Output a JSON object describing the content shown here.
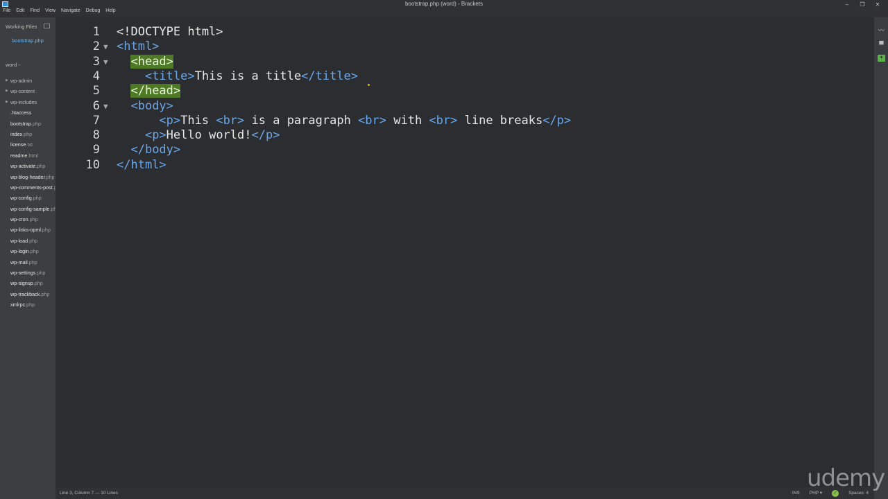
{
  "window": {
    "title": "bootstrap.php (word) - Brackets",
    "controls": [
      "–",
      "❐",
      "✕"
    ]
  },
  "menu": [
    "File",
    "Edit",
    "Find",
    "View",
    "Navigate",
    "Debug",
    "Help"
  ],
  "sidebar": {
    "working_files_label": "Working Files",
    "working_files": [
      "bootstrap.php"
    ],
    "project_label": "word -",
    "tree": [
      {
        "name": "wp-admin",
        "ext": "",
        "folder": true
      },
      {
        "name": "wp-content",
        "ext": "",
        "folder": true
      },
      {
        "name": "wp-includes",
        "ext": "",
        "folder": true
      },
      {
        "name": ".htaccess",
        "ext": "",
        "folder": false
      },
      {
        "name": "bootstrap",
        "ext": ".php",
        "folder": false
      },
      {
        "name": "index",
        "ext": ".php",
        "folder": false
      },
      {
        "name": "license",
        "ext": ".txt",
        "folder": false
      },
      {
        "name": "readme",
        "ext": ".html",
        "folder": false
      },
      {
        "name": "wp-activate",
        "ext": ".php",
        "folder": false
      },
      {
        "name": "wp-blog-header",
        "ext": ".php",
        "folder": false
      },
      {
        "name": "wp-comments-post",
        "ext": ".php",
        "folder": false
      },
      {
        "name": "wp-config",
        "ext": ".php",
        "folder": false
      },
      {
        "name": "wp-config-sample",
        "ext": ".php",
        "folder": false
      },
      {
        "name": "wp-cron",
        "ext": ".php",
        "folder": false
      },
      {
        "name": "wp-links-opml",
        "ext": ".php",
        "folder": false
      },
      {
        "name": "wp-load",
        "ext": ".php",
        "folder": false
      },
      {
        "name": "wp-login",
        "ext": ".php",
        "folder": false
      },
      {
        "name": "wp-mail",
        "ext": ".php",
        "folder": false
      },
      {
        "name": "wp-settings",
        "ext": ".php",
        "folder": false
      },
      {
        "name": "wp-signup",
        "ext": ".php",
        "folder": false
      },
      {
        "name": "wp-trackback",
        "ext": ".php",
        "folder": false
      },
      {
        "name": "xmlrpc",
        "ext": ".php",
        "folder": false
      }
    ]
  },
  "editor": {
    "lines": [
      {
        "n": "1",
        "fold": "",
        "parts": [
          {
            "t": "<!DOCTYPE html>",
            "c": "txt"
          }
        ]
      },
      {
        "n": "2",
        "fold": "▼",
        "parts": [
          {
            "t": "<html>",
            "c": "tag"
          }
        ]
      },
      {
        "n": "3",
        "fold": "▼",
        "parts": [
          {
            "t": "  ",
            "c": "txt"
          },
          {
            "t": "<head",
            "c": "hl"
          },
          {
            "t": "CURSOR",
            "c": "cursor"
          },
          {
            "t": ">",
            "c": "hl"
          }
        ]
      },
      {
        "n": "4",
        "fold": "",
        "parts": [
          {
            "t": "    ",
            "c": "txt"
          },
          {
            "t": "<title>",
            "c": "tag"
          },
          {
            "t": "This is a title",
            "c": "txt"
          },
          {
            "t": "</title>",
            "c": "tag"
          }
        ]
      },
      {
        "n": "5",
        "fold": "",
        "parts": [
          {
            "t": "  ",
            "c": "txt"
          },
          {
            "t": "</head>",
            "c": "hl"
          }
        ]
      },
      {
        "n": "6",
        "fold": "▼",
        "parts": [
          {
            "t": "  ",
            "c": "txt"
          },
          {
            "t": "<body>",
            "c": "tag"
          }
        ]
      },
      {
        "n": "7",
        "fold": "",
        "parts": [
          {
            "t": "      ",
            "c": "txt"
          },
          {
            "t": "<p>",
            "c": "tag"
          },
          {
            "t": "This ",
            "c": "txt"
          },
          {
            "t": "<br>",
            "c": "tag"
          },
          {
            "t": " is a paragraph ",
            "c": "txt"
          },
          {
            "t": "<br>",
            "c": "tag"
          },
          {
            "t": " with ",
            "c": "txt"
          },
          {
            "t": "<br>",
            "c": "tag"
          },
          {
            "t": " line breaks",
            "c": "txt"
          },
          {
            "t": "</p>",
            "c": "tag"
          }
        ]
      },
      {
        "n": "8",
        "fold": "",
        "parts": [
          {
            "t": "    ",
            "c": "txt"
          },
          {
            "t": "<p>",
            "c": "tag"
          },
          {
            "t": "Hello world!",
            "c": "txt"
          },
          {
            "t": "</p>",
            "c": "tag"
          }
        ]
      },
      {
        "n": "9",
        "fold": "",
        "parts": [
          {
            "t": "  ",
            "c": "txt"
          },
          {
            "t": "</body>",
            "c": "tag"
          }
        ]
      },
      {
        "n": "10",
        "fold": "",
        "parts": [
          {
            "t": "</html>",
            "c": "tag"
          }
        ]
      }
    ]
  },
  "statusbar": {
    "position": "Line 3, Column 7 — 10 Lines",
    "mode": "INS",
    "language": "PHP ▾",
    "spaces": "Spaces: 4"
  },
  "watermark": "udemy"
}
